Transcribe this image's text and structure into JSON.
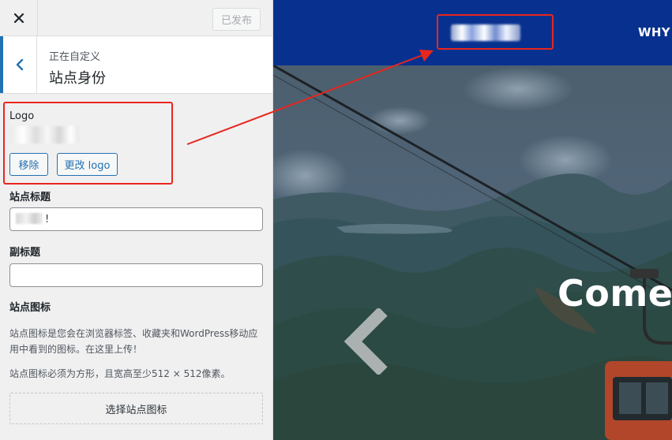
{
  "sidebar": {
    "close_glyph": "✕",
    "publish_label": "已发布",
    "breadcrumb": "正在自定义",
    "section_title": "站点身份",
    "logo": {
      "label": "Logo",
      "remove_label": "移除",
      "change_label": "更改 logo"
    },
    "site_title": {
      "label": "站点标题",
      "value": "!"
    },
    "tagline": {
      "label": "副标题",
      "value": ""
    },
    "site_icon": {
      "label": "站点图标",
      "description": "站点图标是您会在浏览器标签、收藏夹和WordPress移动应用中看到的图标。在这里上传！",
      "size_note": "站点图标必须为方形，且宽高至少512 × 512像素。",
      "select_label": "选择站点图标"
    }
  },
  "preview": {
    "nav_item": "WHY",
    "hero_title": "Come"
  },
  "colors": {
    "wp_blue": "#2271b1",
    "site_header": "#08318f",
    "annotation_red": "#e8261d"
  },
  "icons": {
    "close": "close-icon",
    "back": "chevron-left-icon",
    "slider_prev": "chevron-left-icon"
  }
}
